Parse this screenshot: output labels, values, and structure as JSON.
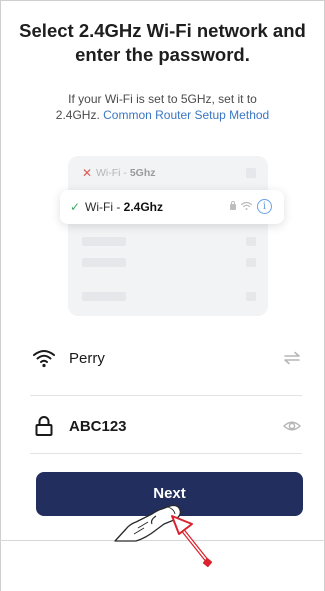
{
  "header": {
    "title": "Select 2.4GHz Wi-Fi network and enter the password."
  },
  "subtitle": {
    "text": "If your Wi-Fi is set to 5GHz, set it to 2.4GHz.",
    "link": "Common Router Setup Method"
  },
  "illustration": {
    "row_5g_prefix": "Wi-Fi - ",
    "row_5g_band": "5Ghz",
    "row_24_prefix": "Wi-Fi - ",
    "row_24_band": "2.4Ghz",
    "row_5g_icon": "x-mark-icon",
    "row_24_icon": "checkmark-icon"
  },
  "form": {
    "ssid_value": "Perry",
    "password_value": "ABC123",
    "ssid_icon": "wifi-icon",
    "ssid_action_icon": "switch-network-icon",
    "password_icon": "lock-icon",
    "password_action_icon": "eye-icon"
  },
  "actions": {
    "next_label": "Next"
  },
  "colors": {
    "button_bg": "#222f5e",
    "link": "#3a76c4",
    "check": "#3aa85a",
    "cross": "#e05a55",
    "annotation_arrow": "#d9232e"
  }
}
